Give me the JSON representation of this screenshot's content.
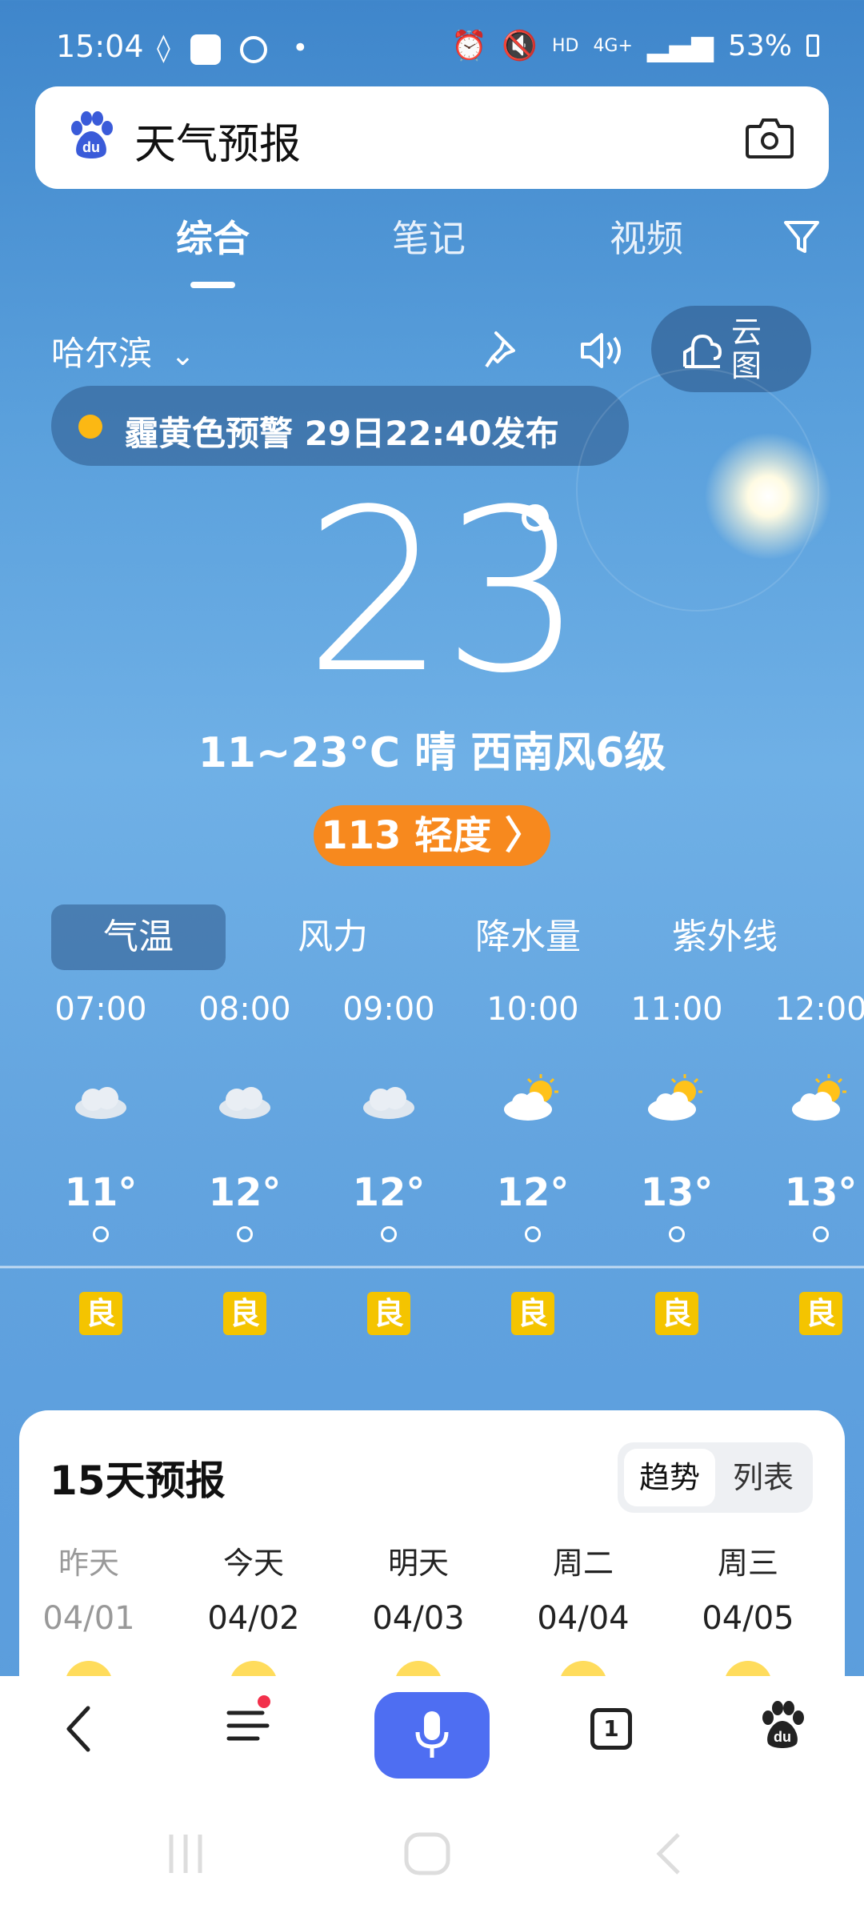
{
  "status_bar": {
    "time": "15:04",
    "battery": "53%",
    "network": "4G+",
    "hd": "HD",
    "dot": "•"
  },
  "search": {
    "query": "天气预报",
    "logo_icon": "baidu-paw-icon",
    "camera_icon": "camera-icon"
  },
  "tabs": [
    {
      "label": "综合",
      "active": true
    },
    {
      "label": "笔记",
      "active": false
    },
    {
      "label": "视频",
      "active": false
    }
  ],
  "filter_icon": "filter-icon",
  "location": {
    "city": "哈尔滨",
    "cloud_map_label": "云图"
  },
  "alert": {
    "text": "霾黄色预警 29日22:40发布",
    "color": "#fcb813"
  },
  "current": {
    "temperature": "23",
    "summary": "11~23°C 晴 西南风6级",
    "aqi": "113 轻度 〉"
  },
  "segments": [
    {
      "label": "气温",
      "active": true
    },
    {
      "label": "风力",
      "active": false
    },
    {
      "label": "降水量",
      "active": false
    },
    {
      "label": "紫外线",
      "active": false
    }
  ],
  "hourly": [
    {
      "time": "07:00",
      "icon": "cloudy-icon",
      "temp": "11°",
      "quality": "良"
    },
    {
      "time": "08:00",
      "icon": "cloudy-icon",
      "temp": "12°",
      "quality": "良"
    },
    {
      "time": "09:00",
      "icon": "cloudy-icon",
      "temp": "12°",
      "quality": "良"
    },
    {
      "time": "10:00",
      "icon": "partly-sunny-icon",
      "temp": "12°",
      "quality": "良"
    },
    {
      "time": "11:00",
      "icon": "partly-sunny-icon",
      "temp": "13°",
      "quality": "良"
    },
    {
      "time": "12:00",
      "icon": "partly-sunny-icon",
      "temp": "13°",
      "quality": "良"
    }
  ],
  "forecast": {
    "title": "15天预报",
    "toggle_trend": "趋势",
    "toggle_list": "列表",
    "days": [
      {
        "name": "昨天",
        "date": "04/01",
        "past": true
      },
      {
        "name": "今天",
        "date": "04/02",
        "past": false
      },
      {
        "name": "明天",
        "date": "04/03",
        "past": false
      },
      {
        "name": "周二",
        "date": "04/04",
        "past": false
      },
      {
        "name": "周三",
        "date": "04/05",
        "past": false
      }
    ]
  },
  "bottom_nav": {
    "tab_count": "1",
    "icons": [
      "back-icon",
      "menu-icon",
      "mic-icon",
      "tabs-icon",
      "baidu-paw-icon"
    ]
  }
}
